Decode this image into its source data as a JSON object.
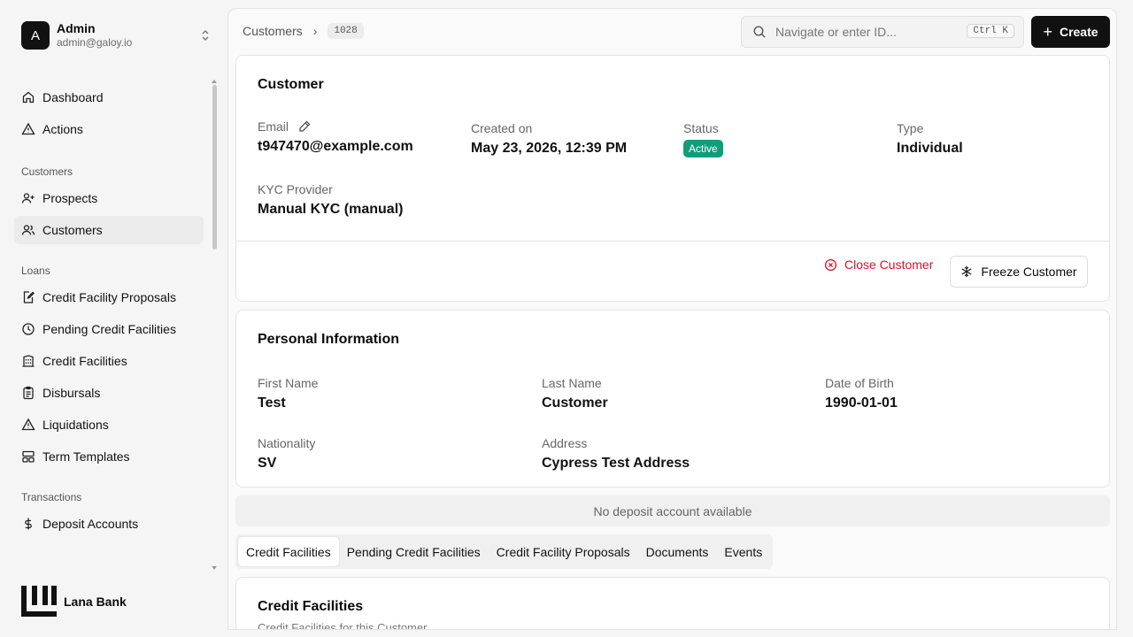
{
  "user": {
    "initial": "A",
    "name": "Admin",
    "email": "admin@galoy.io"
  },
  "nav": {
    "top": [
      {
        "label": "Dashboard",
        "icon": "home-icon"
      },
      {
        "label": "Actions",
        "icon": "warning-triangle-icon"
      }
    ],
    "groups": [
      {
        "title": "Customers",
        "items": [
          {
            "label": "Prospects",
            "icon": "user-plus-icon"
          },
          {
            "label": "Customers",
            "icon": "users-icon",
            "active": true
          }
        ]
      },
      {
        "title": "Loans",
        "items": [
          {
            "label": "Credit Facility Proposals",
            "icon": "edit-document-icon"
          },
          {
            "label": "Pending Credit Facilities",
            "icon": "clock-icon"
          },
          {
            "label": "Credit Facilities",
            "icon": "bank-building-icon"
          },
          {
            "label": "Disbursals",
            "icon": "clipboard-list-icon"
          },
          {
            "label": "Liquidations",
            "icon": "warning-triangle-icon"
          },
          {
            "label": "Term Templates",
            "icon": "layout-template-icon"
          }
        ]
      },
      {
        "title": "Transactions",
        "items": [
          {
            "label": "Deposit Accounts",
            "icon": "dollar-icon"
          }
        ]
      }
    ]
  },
  "brand": {
    "name": "Lana Bank"
  },
  "breadcrumb": {
    "section": "Customers",
    "id": "1028"
  },
  "search": {
    "placeholder": "Navigate or enter ID...",
    "shortcut": "Ctrl K"
  },
  "create_label": "Create",
  "customer": {
    "title": "Customer",
    "email_label": "Email",
    "email": "t947470@example.com",
    "created_label": "Created on",
    "created": "May 23, 2026, 12:39 PM",
    "status_label": "Status",
    "status": "Active",
    "type_label": "Type",
    "type": "Individual",
    "kyc_label": "KYC Provider",
    "kyc": "Manual KYC (manual)",
    "close_label": "Close Customer",
    "freeze_label": "Freeze Customer"
  },
  "personal": {
    "title": "Personal Information",
    "first_name_label": "First Name",
    "first_name": "Test",
    "last_name_label": "Last Name",
    "last_name": "Customer",
    "dob_label": "Date of Birth",
    "dob": "1990-01-01",
    "nationality_label": "Nationality",
    "nationality": "SV",
    "address_label": "Address",
    "address": "Cypress Test Address"
  },
  "no_deposit": "No deposit account available",
  "tabs": [
    "Credit Facilities",
    "Pending Credit Facilities",
    "Credit Facility Proposals",
    "Documents",
    "Events"
  ],
  "credit_facilities": {
    "title": "Credit Facilities",
    "subtitle": "Credit Facilities for this Customer"
  },
  "colors": {
    "accent": "#111111",
    "status_active": "#0f9e7a",
    "danger": "#d9122b"
  }
}
